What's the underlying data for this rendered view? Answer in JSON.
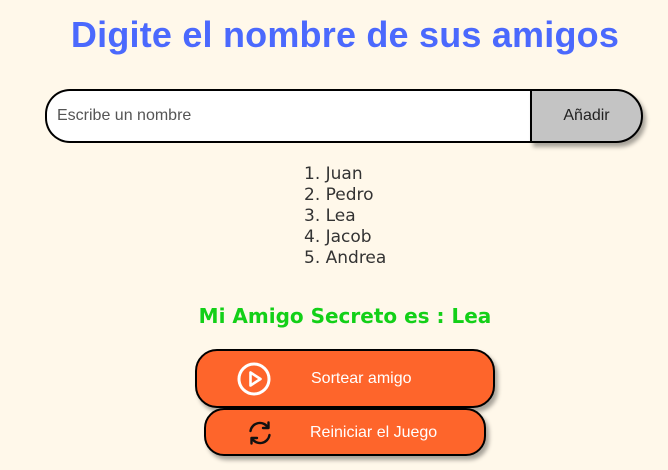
{
  "header": {
    "title": "Digite el nombre de sus amigos"
  },
  "input": {
    "placeholder": "Escribe un nombre",
    "value": "",
    "add_label": "Añadir"
  },
  "friends": [
    "1. Juan",
    "2. Pedro",
    "3. Lea",
    "4. Jacob",
    "5. Andrea"
  ],
  "result": {
    "text": "Mi Amigo Secreto es : Lea"
  },
  "actions": {
    "draw_label": "Sortear amigo",
    "draw_icon": "play-circle-icon",
    "reset_label": "Reiniciar el Juego",
    "reset_icon": "refresh-icon"
  },
  "colors": {
    "background": "#fff8ea",
    "title": "#4b69fd",
    "result": "#13d018",
    "button_primary": "#fe652b",
    "button_add": "#c4c4c4"
  }
}
